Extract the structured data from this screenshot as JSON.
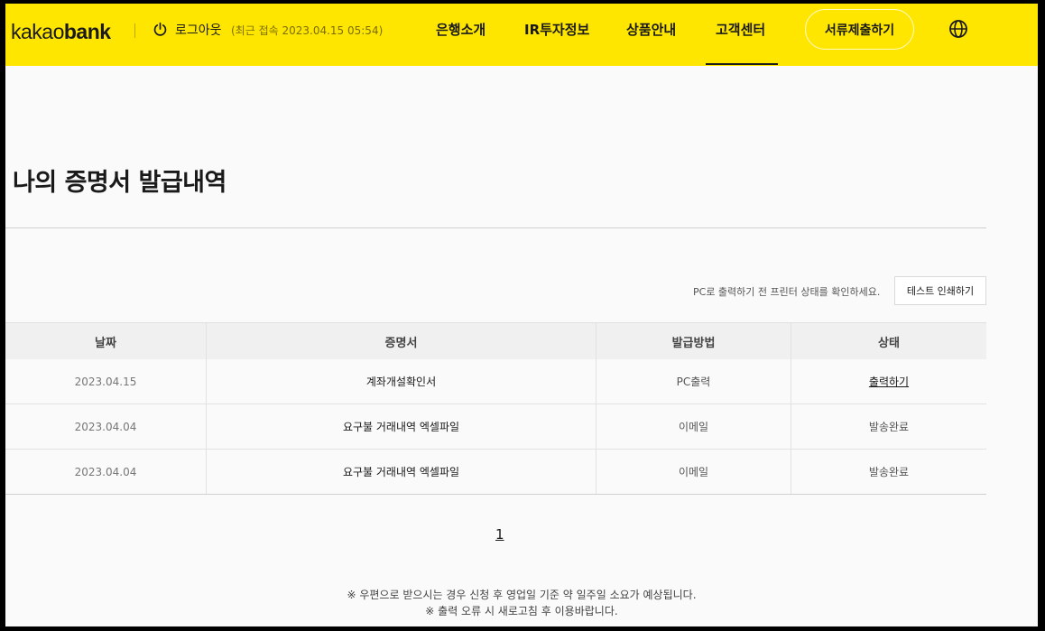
{
  "header": {
    "logo_light": "kakao",
    "logo_bold": "bank",
    "logout_label": "로그아웃",
    "last_access": "(최근 접속 2023.04.15 05:54)",
    "nav": [
      {
        "label": "은행소개"
      },
      {
        "label": "IR투자정보"
      },
      {
        "label": "상품안내"
      },
      {
        "label": "고객센터",
        "active": true
      }
    ],
    "submit_button": "서류제출하기",
    "accent_color": "#ffe600"
  },
  "main": {
    "title": "나의 증명서 발급내역",
    "notice": "PC로 출력하기 전 프린터 상태를 확인하세요.",
    "test_print_button": "테스트 인쇄하기",
    "table": {
      "headers": [
        "날짜",
        "증명서",
        "발급방법",
        "상태"
      ],
      "rows": [
        {
          "date": "2023.04.15",
          "certificate": "계좌개설확인서",
          "method": "PC출력",
          "status": "출력하기",
          "status_is_link": true
        },
        {
          "date": "2023.04.04",
          "certificate": "요구불 거래내역 엑셀파일",
          "method": "이메일",
          "status": "발송완료",
          "status_is_link": false
        },
        {
          "date": "2023.04.04",
          "certificate": "요구불 거래내역 엑셀파일",
          "method": "이메일",
          "status": "발송완료",
          "status_is_link": false
        }
      ]
    },
    "pagination": {
      "current_page": "1"
    },
    "footnotes": [
      "※ 우편으로 받으시는 경우 신청 후 영업일 기준 약 일주일 소요가 예상됩니다.",
      "※ 출력 오류 시 새로고침 후 이용바랍니다."
    ]
  },
  "icons": {
    "power": "power-icon",
    "globe": "globe-icon"
  }
}
